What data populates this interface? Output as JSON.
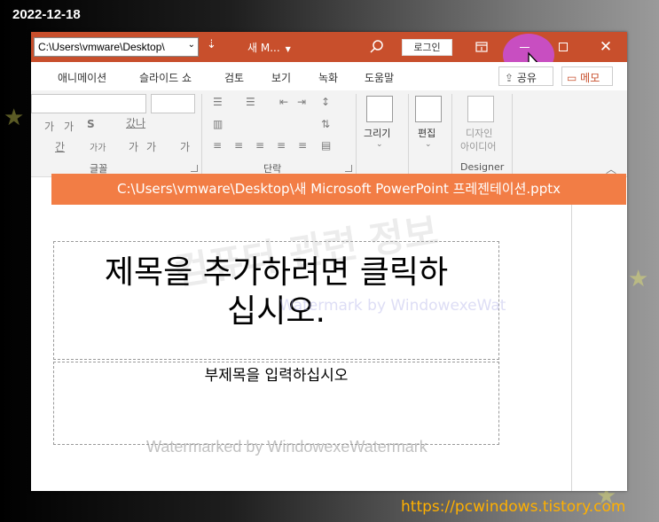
{
  "date": "2022-12-18",
  "titlebar": {
    "path": "C:\\Users\\vmware\\Desktop\\",
    "doc_title": "새 M...",
    "login": "로그인"
  },
  "tabs": [
    "애니메이션",
    "슬라이드 쇼",
    "검토",
    "보기",
    "녹화",
    "도움말"
  ],
  "share": "공유",
  "memo": "메모",
  "ribbon": {
    "font_group": "글꼴",
    "paragraph_group": "단락",
    "designer_group": "Designer",
    "draw": "그리기",
    "edit": "편집",
    "design_ideas_1": "디자인",
    "design_ideas_2": "아이디어",
    "font_btn_a": "가",
    "font_btn_b": "가",
    "bold": "S",
    "char_spacing": "갔나",
    "font_color": "간",
    "font_size_case": "가가",
    "grow_font": "가",
    "shrink_font": "가",
    "clear_format": "가"
  },
  "path_banner": "C:\\Users\\vmware\\Desktop\\새 Microsoft PowerPoint 프레젠테이션.pptx",
  "slide": {
    "title_line1": "제목을 추가하려면 클릭하",
    "title_line2": "십시오.",
    "subtitle": "부제목을 입력하십시오"
  },
  "watermarks": {
    "big": "컴퓨터 관련 정보",
    "mid": "Watermark by WindowexeWat",
    "bottom": "Watermarked by WindowexeWatermark"
  },
  "blog_url": "https://pcwindows.tistory.com",
  "colors": {
    "titlebar": "#c84f2c",
    "banner": "#f27d45",
    "highlight": "#c84ec9",
    "url": "#ffb000"
  }
}
